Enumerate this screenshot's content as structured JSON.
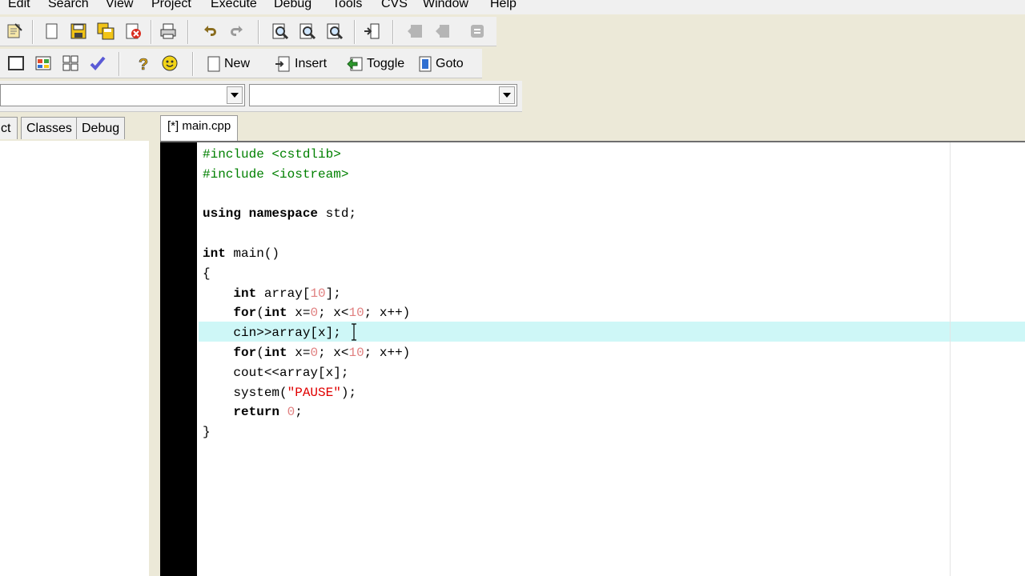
{
  "menu": [
    "Edit",
    "Search",
    "View",
    "Project",
    "Execute",
    "Debug",
    "Tools",
    "CVS",
    "Window",
    "Help"
  ],
  "toolbar2": {
    "new": "New",
    "insert": "Insert",
    "toggle": "Toggle",
    "goto": "Goto"
  },
  "tabs": {
    "project": "ct",
    "classes": "Classes",
    "debug": "Debug"
  },
  "editor_tab": "[*] main.cpp",
  "code": {
    "l1": {
      "pp": "#include <cstdlib>"
    },
    "l2": {
      "pp": "#include <iostream>"
    },
    "l4": {
      "kw": "using namespace",
      "rest": " std;"
    },
    "l6": {
      "kw": "int",
      "rest": " main()"
    },
    "l7": "{",
    "l8": {
      "indent": "    ",
      "kw": "int",
      "a": " array[",
      "n": "10",
      "b": "];"
    },
    "l9": {
      "indent": "    ",
      "kw1": "for",
      "a": "(",
      "kw2": "int",
      "b": " x=",
      "n1": "0",
      "c": "; x<",
      "n2": "10",
      "d": "; x++)"
    },
    "l10": {
      "indent": "    ",
      "a": "cin>>array[x];"
    },
    "l11": {
      "indent": "    ",
      "kw1": "for",
      "a": "(",
      "kw2": "int",
      "b": " x=",
      "n1": "0",
      "c": "; x<",
      "n2": "10",
      "d": "; x++)"
    },
    "l12": {
      "indent": "    ",
      "a": "cout<<array[x];"
    },
    "l13": {
      "indent": "    ",
      "a": "system(",
      "s": "\"PAUSE\"",
      "b": ");"
    },
    "l14": {
      "indent": "    ",
      "kw": "return",
      "a": " ",
      "n": "0",
      "b": ";"
    },
    "l15": "}"
  },
  "colors": {
    "preprocessor": "#008000",
    "number": "#e08080",
    "string": "#e00000",
    "current_line": "#cef7f7",
    "gutter": "#000000"
  }
}
